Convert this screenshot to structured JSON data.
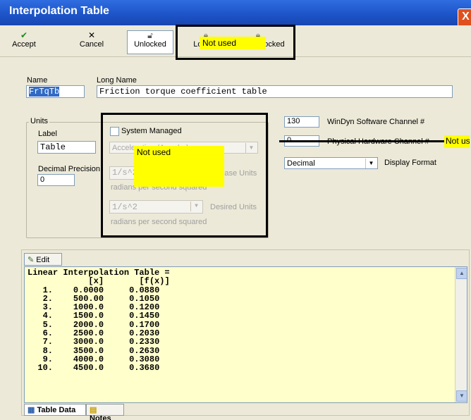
{
  "window": {
    "title": "Interpolation Table",
    "close_glyph": "X"
  },
  "toolbar": {
    "accept_label": "Accept",
    "cancel_label": "Cancel",
    "unlocked_label": "Unlocked",
    "locked_label": "Locked",
    "factory_locked_label": "Factory Locked"
  },
  "annotations": {
    "not_used": "Not used"
  },
  "name": {
    "label": "Name",
    "value": "FrTqTb"
  },
  "long_name": {
    "label": "Long Name",
    "value": "Friction torque coefficient table"
  },
  "units": {
    "group_label": "Units",
    "label_label": "Label",
    "label_value": "Table",
    "decimal_precision_label": "Decimal Precision",
    "decimal_precision_value": "0",
    "system_managed_label": "System Managed",
    "system_managed_checked": false,
    "category_value": "Acceleration (Angular)",
    "base_units_value": "1/s^2",
    "base_units_label": "Base Units",
    "base_units_desc": "radians per second squared",
    "desired_units_value": "1/s^2",
    "desired_units_label": "Desired Units",
    "desired_units_desc": "radians per second squared"
  },
  "channel": {
    "software_value": "130",
    "software_label": "WinDyn Software Channel #",
    "hardware_value": "0",
    "hardware_label": "Physical Hardware Channel #"
  },
  "display_format": {
    "value": "Decimal",
    "label": "Display Format"
  },
  "edit_label": "Edit",
  "table": {
    "header": "Linear Interpolation Table =",
    "col_x": "[x]",
    "col_fx": "[f(x)]",
    "rows": [
      [
        "1.",
        "0.0000",
        "0.0880"
      ],
      [
        "2.",
        "500.00",
        "0.1050"
      ],
      [
        "3.",
        "1000.0",
        "0.1200"
      ],
      [
        "4.",
        "1500.0",
        "0.1450"
      ],
      [
        "5.",
        "2000.0",
        "0.1700"
      ],
      [
        "6.",
        "2500.0",
        "0.2030"
      ],
      [
        "7.",
        "3000.0",
        "0.2330"
      ],
      [
        "8.",
        "3500.0",
        "0.2630"
      ],
      [
        "9.",
        "4000.0",
        "0.3080"
      ],
      [
        "10.",
        "4500.0",
        "0.3680"
      ]
    ]
  },
  "tabs": {
    "table_data": "Table Data",
    "notes": "Notes"
  },
  "colors": {
    "title_bar": "#1c53c7",
    "annotation_highlight": "#ffff00",
    "table_background": "#ffffcc"
  }
}
